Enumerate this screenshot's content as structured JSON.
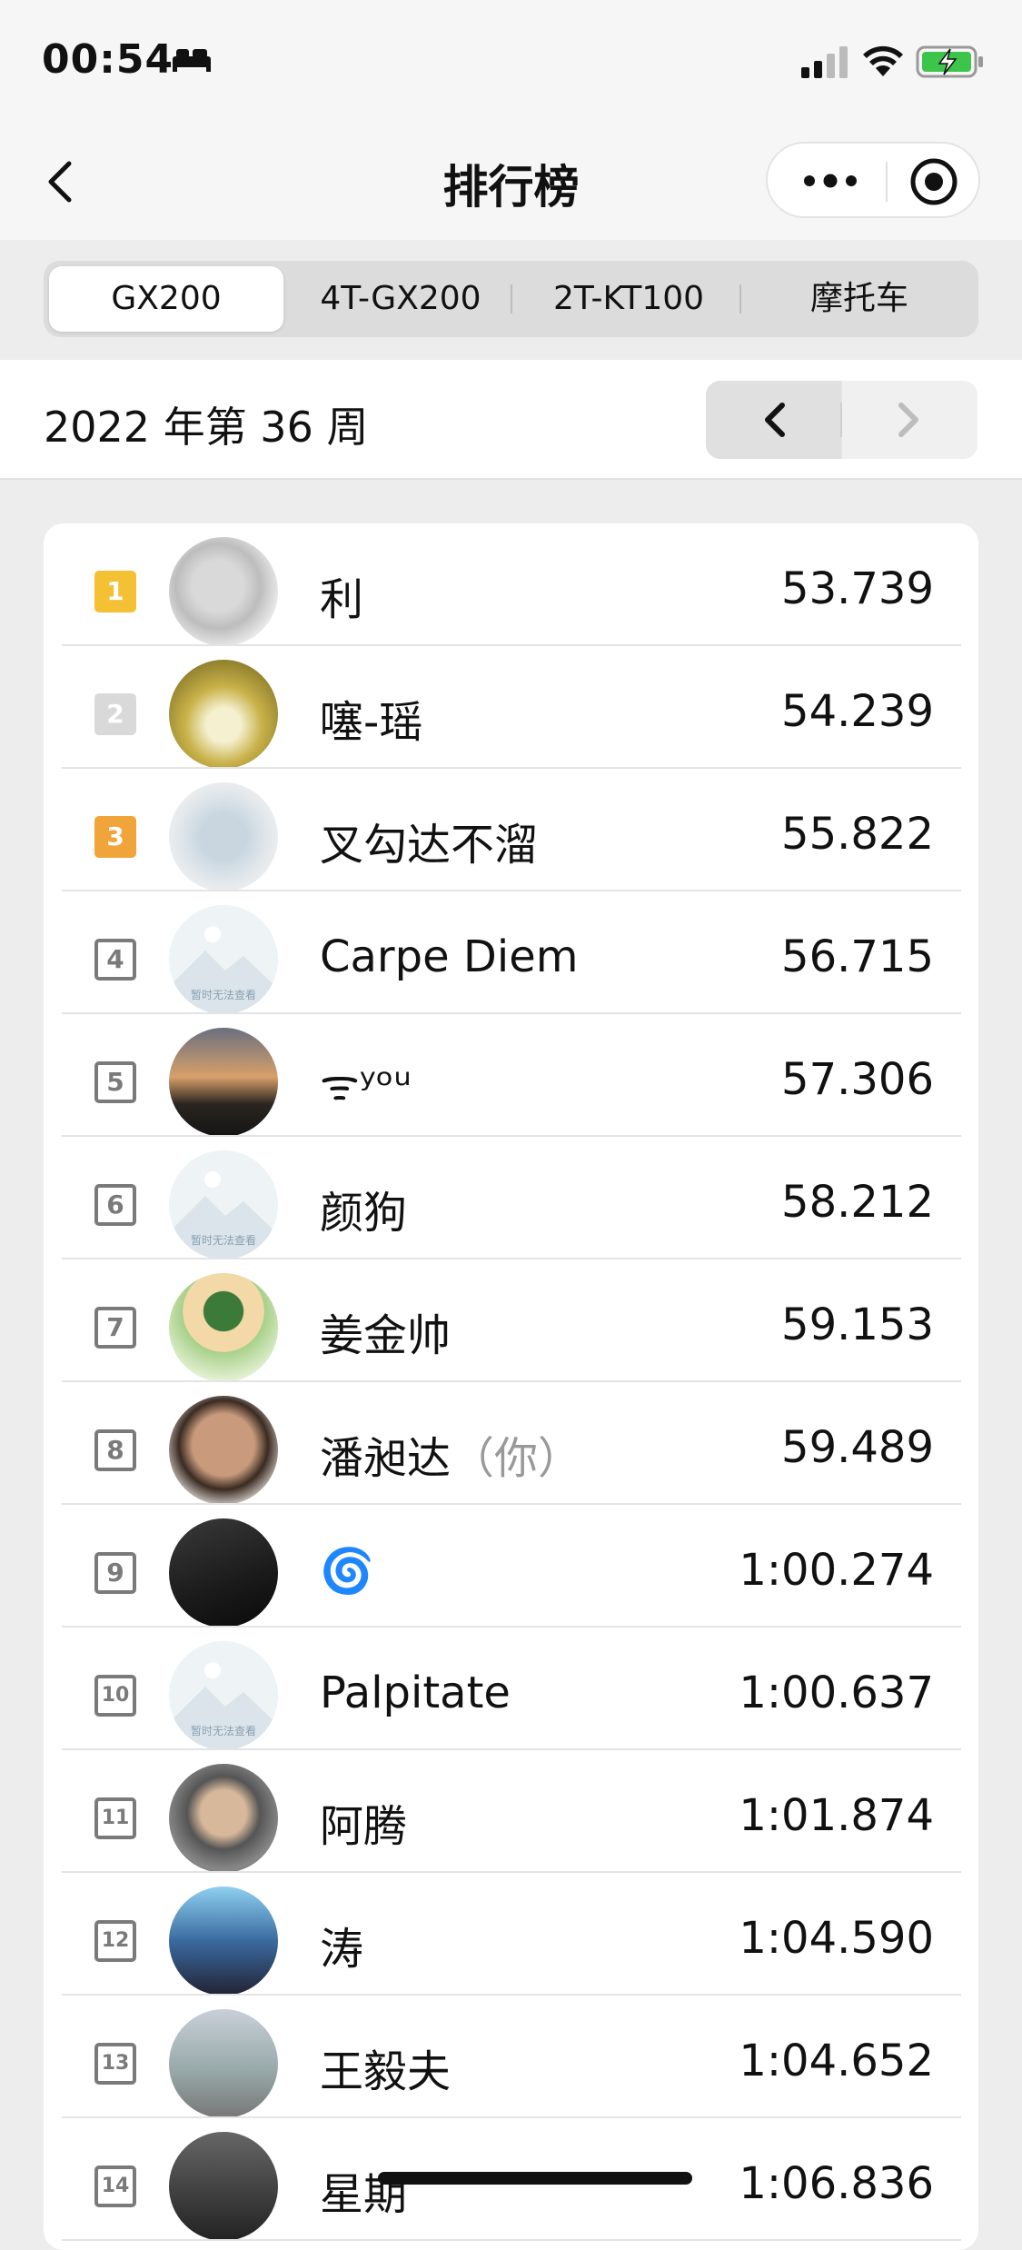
{
  "status_bar": {
    "time": "00:54",
    "icons": [
      "bed-icon",
      "signal-icon",
      "wifi-icon",
      "battery-charging-icon"
    ]
  },
  "nav": {
    "title": "排行榜",
    "back_icon": "chevron-left-icon",
    "more_icon": "more-dots-icon",
    "close_icon": "target-circle-icon"
  },
  "tabs": [
    {
      "label": "GX200",
      "active": true
    },
    {
      "label": "4T-GX200",
      "active": false
    },
    {
      "label": "2T-KT100",
      "active": false
    },
    {
      "label": "摩托车",
      "active": false
    }
  ],
  "week": {
    "label": "2022 年第 36 周",
    "prev_icon": "chevron-left-icon",
    "next_icon": "chevron-right-icon"
  },
  "leaderboard": [
    {
      "rank": "1",
      "name": "利",
      "you": "",
      "time": "53.739",
      "medal": "gold"
    },
    {
      "rank": "2",
      "name": "噻-瑶",
      "you": "",
      "time": "54.239",
      "medal": "silver"
    },
    {
      "rank": "3",
      "name": "叉勾达不溜",
      "you": "",
      "time": "55.822",
      "medal": "bronze"
    },
    {
      "rank": "4",
      "name": "Carpe Diem",
      "you": "",
      "time": "56.715",
      "medal": "plain"
    },
    {
      "rank": "5",
      "name": "ᯤʸᵒᵘ",
      "you": "",
      "time": "57.306",
      "medal": "plain"
    },
    {
      "rank": "6",
      "name": "颜狗",
      "you": "",
      "time": "58.212",
      "medal": "plain"
    },
    {
      "rank": "7",
      "name": "姜金帅",
      "you": "",
      "time": "59.153",
      "medal": "plain"
    },
    {
      "rank": "8",
      "name": "潘昶达",
      "you": "（你）",
      "time": "59.489",
      "medal": "plain"
    },
    {
      "rank": "9",
      "name": "🌀",
      "you": "",
      "time": "1:00.274",
      "medal": "plain"
    },
    {
      "rank": "10",
      "name": "Palpitate",
      "you": "",
      "time": "1:00.637",
      "medal": "plain"
    },
    {
      "rank": "11",
      "name": "阿腾",
      "you": "",
      "time": "1:01.874",
      "medal": "plain"
    },
    {
      "rank": "12",
      "name": "涛",
      "you": "",
      "time": "1:04.590",
      "medal": "plain"
    },
    {
      "rank": "13",
      "name": "王毅夫",
      "you": "",
      "time": "1:04.652",
      "medal": "plain"
    },
    {
      "rank": "14",
      "name": "星期",
      "you": "",
      "time": "1:06.836",
      "medal": "plain"
    }
  ],
  "placeholder_avatar_text": "暂时无法查看",
  "colors": {
    "gold": "#f3c133",
    "silver": "#d9d9d9",
    "bronze": "#f1a43a"
  }
}
